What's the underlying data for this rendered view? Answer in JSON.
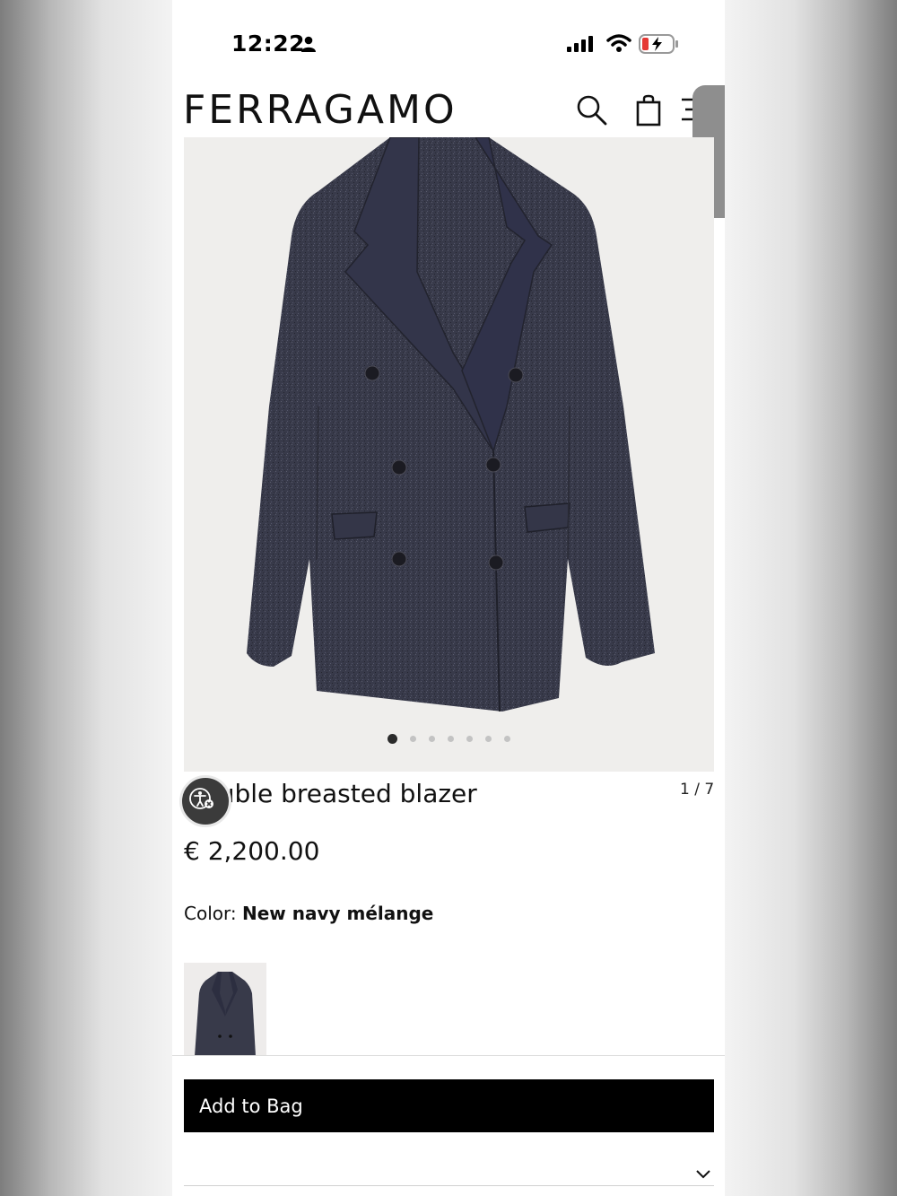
{
  "status_bar": {
    "time": "12:22"
  },
  "header": {
    "logo": "FERRAGAMO",
    "icons": [
      "search-icon",
      "bag-icon",
      "menu-icon"
    ]
  },
  "gallery": {
    "total_images": 7,
    "active_index": 1,
    "counter": "1 / 7"
  },
  "product": {
    "title": "Double breasted blazer",
    "price": "€ 2,200.00",
    "color_label": "Color:",
    "color_value": "New navy mélange"
  },
  "actions": {
    "add_to_bag": "Add to Bag"
  },
  "colors": {
    "fabric": "#3a3b4a",
    "fabric_dark": "#262733",
    "image_bg": "#efeeec",
    "button_bg": "#000000"
  }
}
